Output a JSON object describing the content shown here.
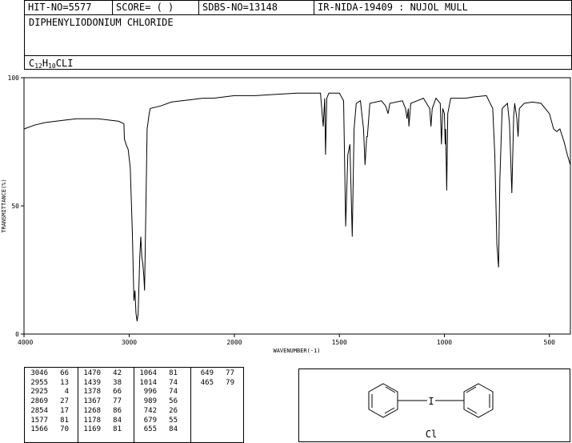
{
  "header": {
    "hit_no": "HIT-NO=5577",
    "score": "SCORE=  (   )",
    "sdbs_no": "SDBS-NO=13148",
    "ir_id": "IR-NIDA-19409 : NUJOL MULL"
  },
  "compound_name": "DIPHENYLIODONIUM CHLORIDE",
  "formula": {
    "c": "C",
    "c_n": "12",
    "h": "H",
    "h_n": "10",
    "rest": "CLI"
  },
  "chart_data": {
    "type": "line",
    "xlabel": "WAVENUMBER(-1)",
    "ylabel": "TRANSMITTANCE(%)",
    "xlim": [
      4000,
      400
    ],
    "ylim": [
      0,
      100
    ],
    "x_ticks": [
      "4000",
      "3000",
      "2000",
      "1500",
      "1000",
      "500"
    ],
    "y_ticks": [
      "0",
      "50",
      "100"
    ],
    "spectrum": [
      [
        4000,
        80
      ],
      [
        3900,
        81.5
      ],
      [
        3800,
        82.5
      ],
      [
        3700,
        83
      ],
      [
        3600,
        83.5
      ],
      [
        3500,
        84
      ],
      [
        3400,
        84
      ],
      [
        3300,
        84
      ],
      [
        3200,
        83.5
      ],
      [
        3100,
        83
      ],
      [
        3050,
        82
      ],
      [
        3046,
        76
      ],
      [
        3030,
        74
      ],
      [
        3010,
        72
      ],
      [
        2990,
        65
      ],
      [
        2970,
        40
      ],
      [
        2955,
        13
      ],
      [
        2945,
        17
      ],
      [
        2935,
        8
      ],
      [
        2925,
        5
      ],
      [
        2915,
        8
      ],
      [
        2900,
        30
      ],
      [
        2890,
        38
      ],
      [
        2880,
        30
      ],
      [
        2869,
        27
      ],
      [
        2860,
        22
      ],
      [
        2854,
        17
      ],
      [
        2845,
        40
      ],
      [
        2830,
        80
      ],
      [
        2810,
        86
      ],
      [
        2800,
        88
      ],
      [
        2700,
        89
      ],
      [
        2600,
        90.5
      ],
      [
        2500,
        91
      ],
      [
        2400,
        91.5
      ],
      [
        2300,
        92
      ],
      [
        2200,
        92
      ],
      [
        2100,
        92.5
      ],
      [
        2000,
        93
      ],
      [
        1900,
        93
      ],
      [
        1800,
        93.5
      ],
      [
        1700,
        94
      ],
      [
        1620,
        94
      ],
      [
        1590,
        94
      ],
      [
        1577,
        81
      ],
      [
        1570,
        92
      ],
      [
        1566,
        70
      ],
      [
        1560,
        92
      ],
      [
        1550,
        94
      ],
      [
        1500,
        94
      ],
      [
        1480,
        91
      ],
      [
        1470,
        42
      ],
      [
        1460,
        70
      ],
      [
        1450,
        74
      ],
      [
        1439,
        38
      ],
      [
        1430,
        80
      ],
      [
        1420,
        90
      ],
      [
        1400,
        91
      ],
      [
        1385,
        80
      ],
      [
        1378,
        66
      ],
      [
        1370,
        77
      ],
      [
        1367,
        77
      ],
      [
        1355,
        90
      ],
      [
        1300,
        91
      ],
      [
        1280,
        89
      ],
      [
        1268,
        86
      ],
      [
        1260,
        90
      ],
      [
        1200,
        91
      ],
      [
        1185,
        88
      ],
      [
        1178,
        84
      ],
      [
        1172,
        88
      ],
      [
        1169,
        81
      ],
      [
        1160,
        90
      ],
      [
        1100,
        92
      ],
      [
        1070,
        88
      ],
      [
        1064,
        81
      ],
      [
        1058,
        88
      ],
      [
        1040,
        92
      ],
      [
        1020,
        90
      ],
      [
        1014,
        74
      ],
      [
        1008,
        88
      ],
      [
        1000,
        86
      ],
      [
        996,
        74
      ],
      [
        994,
        80
      ],
      [
        989,
        56
      ],
      [
        984,
        86
      ],
      [
        970,
        92
      ],
      [
        950,
        92
      ],
      [
        900,
        92
      ],
      [
        860,
        92.5
      ],
      [
        800,
        93
      ],
      [
        770,
        88
      ],
      [
        760,
        70
      ],
      [
        750,
        35
      ],
      [
        742,
        26
      ],
      [
        736,
        60
      ],
      [
        725,
        88
      ],
      [
        700,
        90
      ],
      [
        690,
        82
      ],
      [
        679,
        55
      ],
      [
        670,
        85
      ],
      [
        665,
        90
      ],
      [
        655,
        84
      ],
      [
        649,
        77
      ],
      [
        643,
        88
      ],
      [
        620,
        90
      ],
      [
        580,
        90.5
      ],
      [
        540,
        90
      ],
      [
        520,
        88
      ],
      [
        500,
        86
      ],
      [
        480,
        80
      ],
      [
        465,
        79
      ],
      [
        450,
        80
      ],
      [
        430,
        75
      ],
      [
        415,
        70
      ],
      [
        400,
        66
      ]
    ],
    "peaks_table": [
      [
        [
          "3046",
          "66"
        ],
        [
          "2955",
          "13"
        ],
        [
          "2925",
          "4"
        ],
        [
          "2869",
          "27"
        ],
        [
          "2854",
          "17"
        ],
        [
          "1577",
          "81"
        ],
        [
          "1566",
          "70"
        ]
      ],
      [
        [
          "1470",
          "42"
        ],
        [
          "1439",
          "38"
        ],
        [
          "1378",
          "66"
        ],
        [
          "1367",
          "77"
        ],
        [
          "1268",
          "86"
        ],
        [
          "1178",
          "84"
        ],
        [
          "1169",
          "81"
        ]
      ],
      [
        [
          "1064",
          "81"
        ],
        [
          "1014",
          "74"
        ],
        [
          "996",
          "74"
        ],
        [
          "989",
          "56"
        ],
        [
          "742",
          "26"
        ],
        [
          "679",
          "55"
        ],
        [
          "655",
          "84"
        ]
      ],
      [
        [
          "649",
          "77"
        ],
        [
          "465",
          "79"
        ]
      ]
    ]
  },
  "structure": {
    "center_atom": "I",
    "counter_ion": "Cl"
  }
}
